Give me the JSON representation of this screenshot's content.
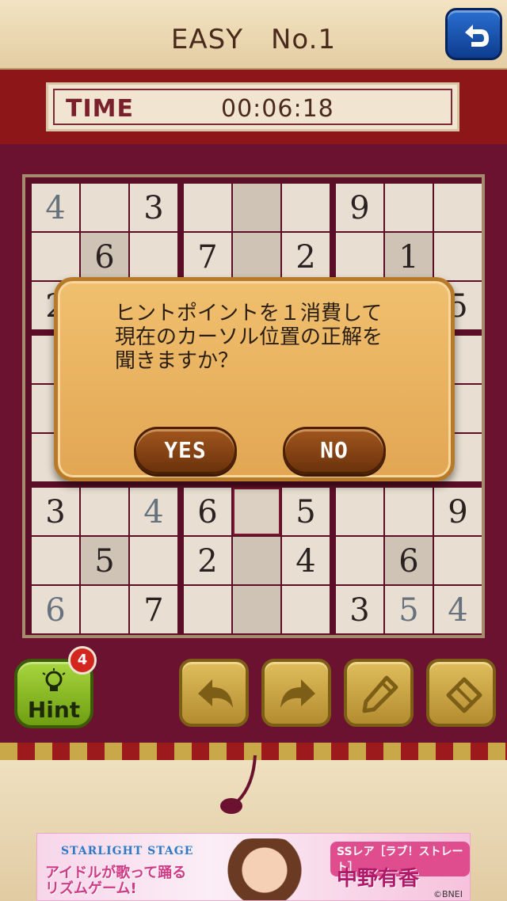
{
  "header": {
    "title": "EASY　No.1",
    "back_icon": "undo-arrow-icon"
  },
  "timer": {
    "label": "TIME",
    "value": "00:06:18"
  },
  "board": {
    "rows": [
      [
        {
          "v": "4",
          "t": "user"
        },
        {
          "v": "",
          "t": ""
        },
        {
          "v": "3",
          "t": "given"
        },
        {
          "v": "",
          "t": ""
        },
        {
          "v": "",
          "t": ""
        },
        {
          "v": "",
          "t": ""
        },
        {
          "v": "9",
          "t": "given"
        },
        {
          "v": "",
          "t": ""
        },
        {
          "v": "",
          "t": ""
        }
      ],
      [
        {
          "v": "",
          "t": ""
        },
        {
          "v": "6",
          "t": "given"
        },
        {
          "v": "",
          "t": ""
        },
        {
          "v": "7",
          "t": "given"
        },
        {
          "v": "",
          "t": ""
        },
        {
          "v": "2",
          "t": "given"
        },
        {
          "v": "",
          "t": ""
        },
        {
          "v": "1",
          "t": "given"
        },
        {
          "v": "",
          "t": ""
        }
      ],
      [
        {
          "v": "2",
          "t": "given"
        },
        {
          "v": "",
          "t": ""
        },
        {
          "v": "",
          "t": ""
        },
        {
          "v": "",
          "t": ""
        },
        {
          "v": "",
          "t": ""
        },
        {
          "v": "",
          "t": ""
        },
        {
          "v": "",
          "t": ""
        },
        {
          "v": "",
          "t": ""
        },
        {
          "v": "5",
          "t": "given"
        }
      ],
      [
        {
          "v": "",
          "t": ""
        },
        {
          "v": "",
          "t": ""
        },
        {
          "v": "",
          "t": ""
        },
        {
          "v": "",
          "t": ""
        },
        {
          "v": "",
          "t": ""
        },
        {
          "v": "",
          "t": ""
        },
        {
          "v": "",
          "t": ""
        },
        {
          "v": "",
          "t": ""
        },
        {
          "v": "",
          "t": ""
        }
      ],
      [
        {
          "v": "",
          "t": ""
        },
        {
          "v": "",
          "t": ""
        },
        {
          "v": "",
          "t": ""
        },
        {
          "v": "",
          "t": ""
        },
        {
          "v": "",
          "t": ""
        },
        {
          "v": "",
          "t": ""
        },
        {
          "v": "",
          "t": ""
        },
        {
          "v": "",
          "t": ""
        },
        {
          "v": "",
          "t": ""
        }
      ],
      [
        {
          "v": "",
          "t": ""
        },
        {
          "v": "",
          "t": ""
        },
        {
          "v": "",
          "t": ""
        },
        {
          "v": "",
          "t": ""
        },
        {
          "v": "",
          "t": ""
        },
        {
          "v": "",
          "t": ""
        },
        {
          "v": "",
          "t": ""
        },
        {
          "v": "",
          "t": ""
        },
        {
          "v": "",
          "t": ""
        }
      ],
      [
        {
          "v": "3",
          "t": "given"
        },
        {
          "v": "",
          "t": ""
        },
        {
          "v": "4",
          "t": "user"
        },
        {
          "v": "6",
          "t": "given"
        },
        {
          "v": "",
          "t": "selected"
        },
        {
          "v": "5",
          "t": "given"
        },
        {
          "v": "",
          "t": ""
        },
        {
          "v": "",
          "t": ""
        },
        {
          "v": "9",
          "t": "given"
        }
      ],
      [
        {
          "v": "",
          "t": ""
        },
        {
          "v": "5",
          "t": "given"
        },
        {
          "v": "",
          "t": ""
        },
        {
          "v": "2",
          "t": "given"
        },
        {
          "v": "",
          "t": ""
        },
        {
          "v": "4",
          "t": "given"
        },
        {
          "v": "",
          "t": ""
        },
        {
          "v": "6",
          "t": "given"
        },
        {
          "v": "",
          "t": ""
        }
      ],
      [
        {
          "v": "6",
          "t": "user"
        },
        {
          "v": "",
          "t": ""
        },
        {
          "v": "7",
          "t": "given"
        },
        {
          "v": "",
          "t": ""
        },
        {
          "v": "",
          "t": ""
        },
        {
          "v": "",
          "t": ""
        },
        {
          "v": "3",
          "t": "given"
        },
        {
          "v": "5",
          "t": "user"
        },
        {
          "v": "4",
          "t": "user"
        }
      ]
    ]
  },
  "dialog": {
    "message": "ヒントポイントを１消費して\n現在のカーソル位置の正解を\n聞きますか？",
    "yes_label": "YES",
    "no_label": "NO"
  },
  "controls": {
    "hint_label": "Hint",
    "hint_count": "4",
    "hint_icon": "lightbulb-icon",
    "undo_icon": "undo-arrow-icon",
    "redo_icon": "redo-arrow-icon",
    "pencil_icon": "pencil-icon",
    "eraser_icon": "eraser-icon"
  },
  "ad": {
    "logo": "STARLIGHT STAGE",
    "tagline": "アイドルが歌って踊る\nリズムゲーム!",
    "rarity": "SSレア［ラブ！ストレート］",
    "name": "中野有香",
    "copyright": "©BNEI"
  }
}
